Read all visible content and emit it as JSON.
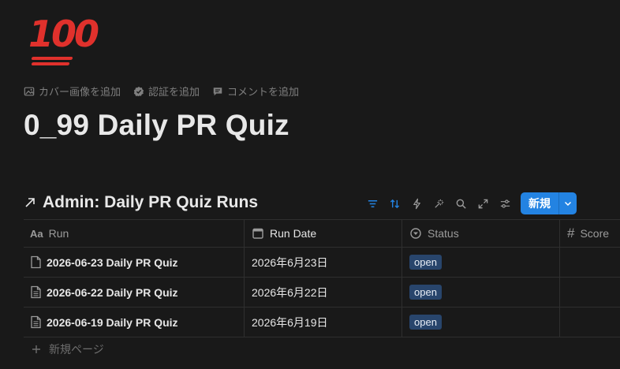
{
  "page": {
    "icon": "💯",
    "icon_text": "100",
    "title": "0_99 Daily PR Quiz",
    "actions": [
      {
        "icon": "image-icon",
        "label": "カバー画像を追加"
      },
      {
        "icon": "verified-badge-icon",
        "label": "認証を追加"
      },
      {
        "icon": "comment-icon",
        "label": "コメントを追加"
      }
    ]
  },
  "database": {
    "title": "Admin: Daily PR Quiz Runs",
    "toolbar": {
      "icons": [
        "filter-icon",
        "sort-icon",
        "automation-icon",
        "ai-sparkle-icon",
        "search-icon",
        "expand-icon",
        "settings-sliders-icon"
      ],
      "new_label": "新規"
    },
    "columns": [
      {
        "icon": "text-property-icon",
        "icon_text": "Aa",
        "label": "Run"
      },
      {
        "icon": "calendar-icon",
        "label": "Run Date"
      },
      {
        "icon": "status-icon",
        "label": "Status"
      },
      {
        "icon": "number-property-icon",
        "icon_text": "#",
        "label": "Score"
      }
    ],
    "rows": [
      {
        "icon": "page-icon",
        "name": "2026-06-23 Daily PR Quiz",
        "date": "2026年6月23日",
        "status": "open",
        "score": ""
      },
      {
        "icon": "page-text-icon",
        "name": "2026-06-22 Daily PR Quiz",
        "date": "2026年6月22日",
        "status": "open",
        "score": ""
      },
      {
        "icon": "page-text-icon",
        "name": "2026-06-19 Daily PR Quiz",
        "date": "2026年6月19日",
        "status": "open",
        "score": ""
      }
    ],
    "new_page_label": "新規ページ"
  },
  "colors": {
    "background": "#191919",
    "accent": "#2383e2",
    "status_badge": "#28456c",
    "emoji_red": "#e0312c"
  }
}
